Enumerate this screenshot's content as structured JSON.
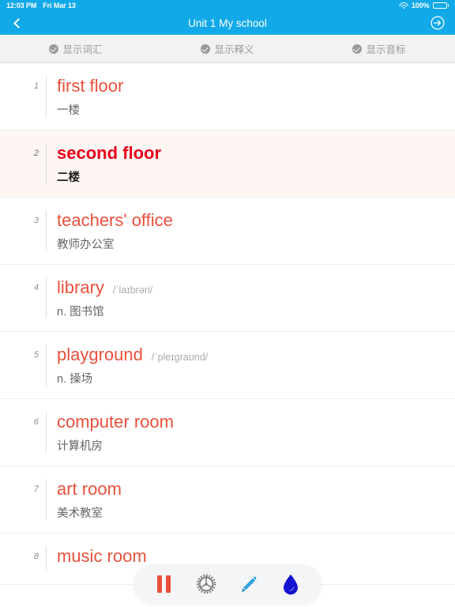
{
  "statusbar": {
    "time": "12:03 PM",
    "date": "Fri Mar 13",
    "battery_percent": "100%",
    "wifi_icon": "wifi-icon",
    "battery_icon": "battery-full-icon"
  },
  "navbar": {
    "title": "Unit 1 My school",
    "back_icon": "chevron-left-icon",
    "right_icon": "arrow-right-circle-icon"
  },
  "options": [
    {
      "label": "显示词汇",
      "checked": true,
      "icon": "check-circle-icon"
    },
    {
      "label": "显示释义",
      "checked": true,
      "icon": "check-circle-icon"
    },
    {
      "label": "显示音标",
      "checked": true,
      "icon": "check-circle-icon"
    }
  ],
  "words": [
    {
      "num": "1",
      "word": "first floor",
      "phonetic": "",
      "meaning": "一楼",
      "selected": false
    },
    {
      "num": "2",
      "word": "second floor",
      "phonetic": "",
      "meaning": "二楼",
      "selected": true
    },
    {
      "num": "3",
      "word": "teachers' office",
      "phonetic": "",
      "meaning": "教师办公室",
      "selected": false
    },
    {
      "num": "4",
      "word": "library",
      "phonetic": "/ˈlaɪbrəri/",
      "meaning": "n. 图书馆",
      "selected": false
    },
    {
      "num": "5",
      "word": "playground",
      "phonetic": "/ˈpleɪɡraʊnd/",
      "meaning": "n. 操场",
      "selected": false
    },
    {
      "num": "6",
      "word": "computer room",
      "phonetic": "",
      "meaning": "计算机房",
      "selected": false
    },
    {
      "num": "7",
      "word": "art room",
      "phonetic": "",
      "meaning": "美术教室",
      "selected": false
    },
    {
      "num": "8",
      "word": "music room",
      "phonetic": "",
      "meaning": "",
      "selected": false
    }
  ],
  "toolbar": {
    "buttons": [
      {
        "name": "pause-button",
        "icon": "pause-icon"
      },
      {
        "name": "settings-button",
        "icon": "gear-icon"
      },
      {
        "name": "edit-button",
        "icon": "pencil-icon"
      },
      {
        "name": "highlight-button",
        "icon": "droplet-icon"
      }
    ]
  },
  "colors": {
    "nav_blue": "#12a9e8",
    "word_red": "#e8503c",
    "selected_word_red": "#e8001c",
    "selected_row_bg": "#fdf6f2",
    "pencil_blue": "#1e9ad6",
    "droplet_blue": "#1414d2",
    "gear_gray": "#808080"
  }
}
